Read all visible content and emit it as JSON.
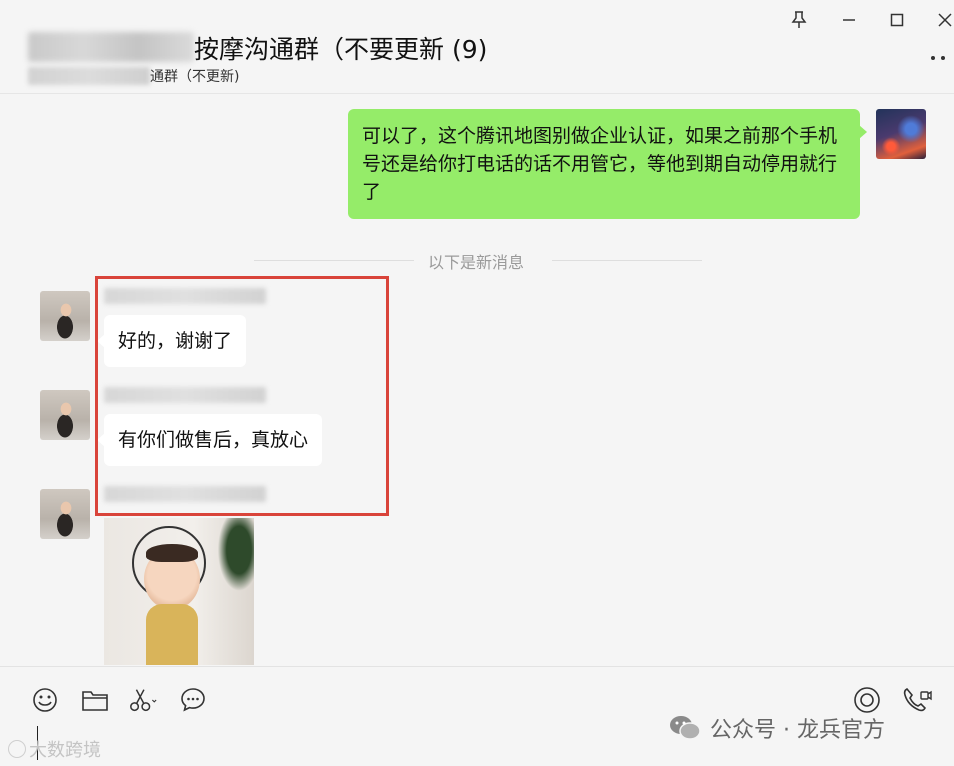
{
  "header": {
    "title": "按摩沟通群（不要更新 (9)",
    "subtitle": "通群（不更新)",
    "pin_icon": "pin-icon",
    "more_icon": "more-dots-icon"
  },
  "window_controls": {
    "minimize": "─",
    "maximize": "☐",
    "close": "✕",
    "pin": "⚲"
  },
  "messages": {
    "outgoing_1": "可以了，这个腾讯地图别做企业认证，如果之前那个手机号还是给你打电话的话不用管它，等他到期自动停用就行了",
    "divider": "以下是新消息",
    "incoming_1": "好的，谢谢了",
    "incoming_2": "有你们做售后，真放心"
  },
  "toolbar": {
    "emoji_icon": "emoji-icon",
    "folder_icon": "folder-icon",
    "scissors_icon": "scissors-icon",
    "chat_icon": "chat-bubble-icon",
    "live_icon": "live-circle-icon",
    "call_icon": "phone-video-icon"
  },
  "watermarks": {
    "left": "大数跨境",
    "right": "公众号 · 龙兵官方"
  },
  "colors": {
    "bubble_me": "#95ec69",
    "bubble_other": "#ffffff",
    "highlight": "#d9443a",
    "background": "#f5f5f5"
  }
}
